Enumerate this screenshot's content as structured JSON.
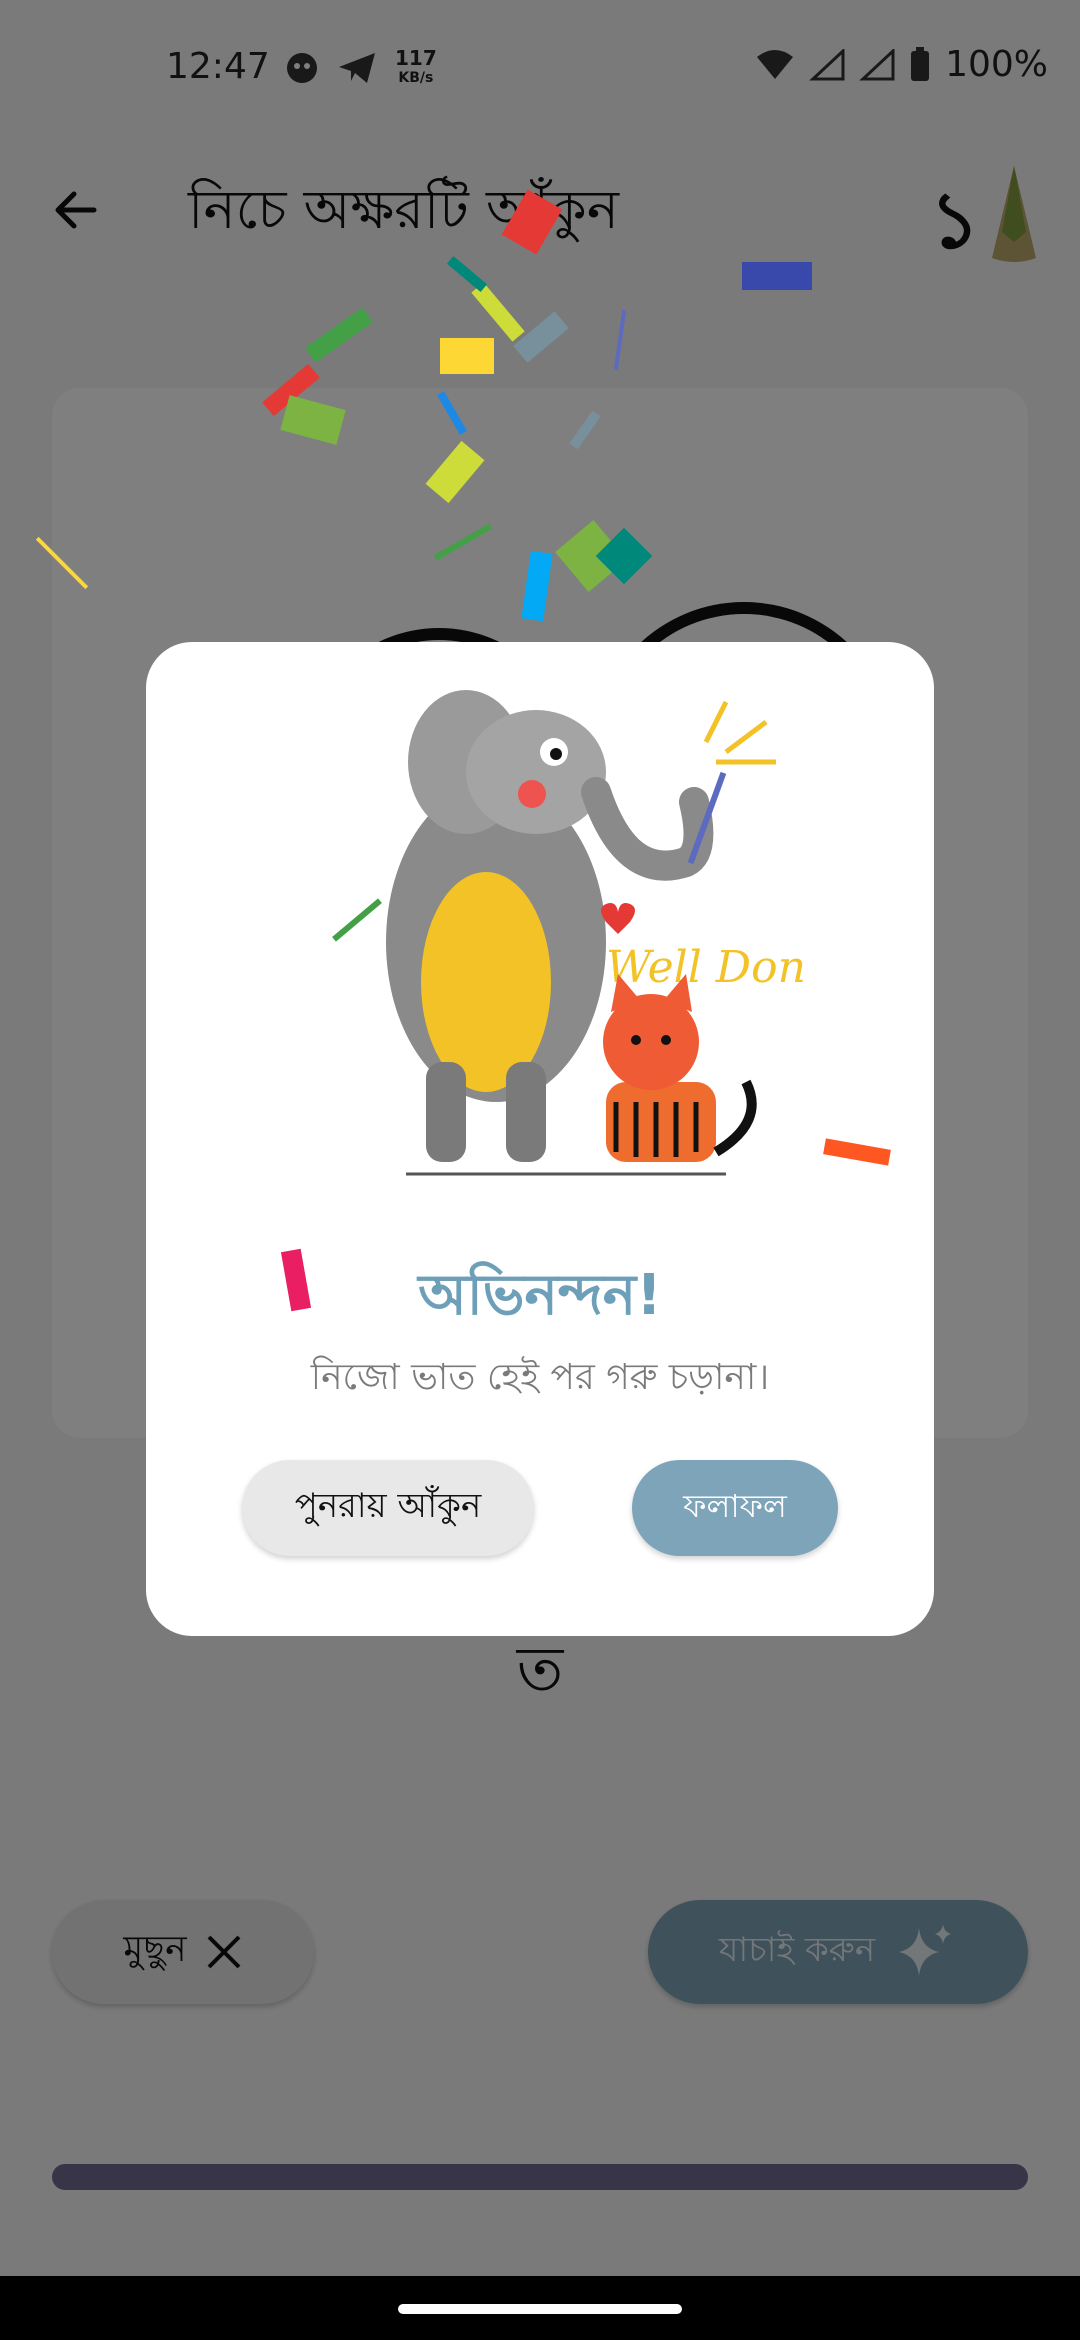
{
  "status_bar": {
    "time": "12:47",
    "net_speed_value": "117",
    "net_speed_unit": "KB/s",
    "battery": "100%"
  },
  "header": {
    "title": "নিচে অক্ষরটি আঁকুন",
    "count": "১"
  },
  "canvas": {
    "letter_hint": "ত"
  },
  "actions": {
    "clear_label": "মুছুন",
    "verify_label": "যাচাই করুন"
  },
  "dialog": {
    "illustration_text": "Well Done",
    "title": "অভিনন্দন!",
    "message": "নিজো ভাত হেই পর গরু চড়ানা।",
    "redraw_label": "পুনরায় আঁকুন",
    "result_label": "ফলাফল"
  },
  "colors": {
    "accent": "#7ea4b9",
    "title_color": "#6e9fb8",
    "scrim": "#000000"
  }
}
